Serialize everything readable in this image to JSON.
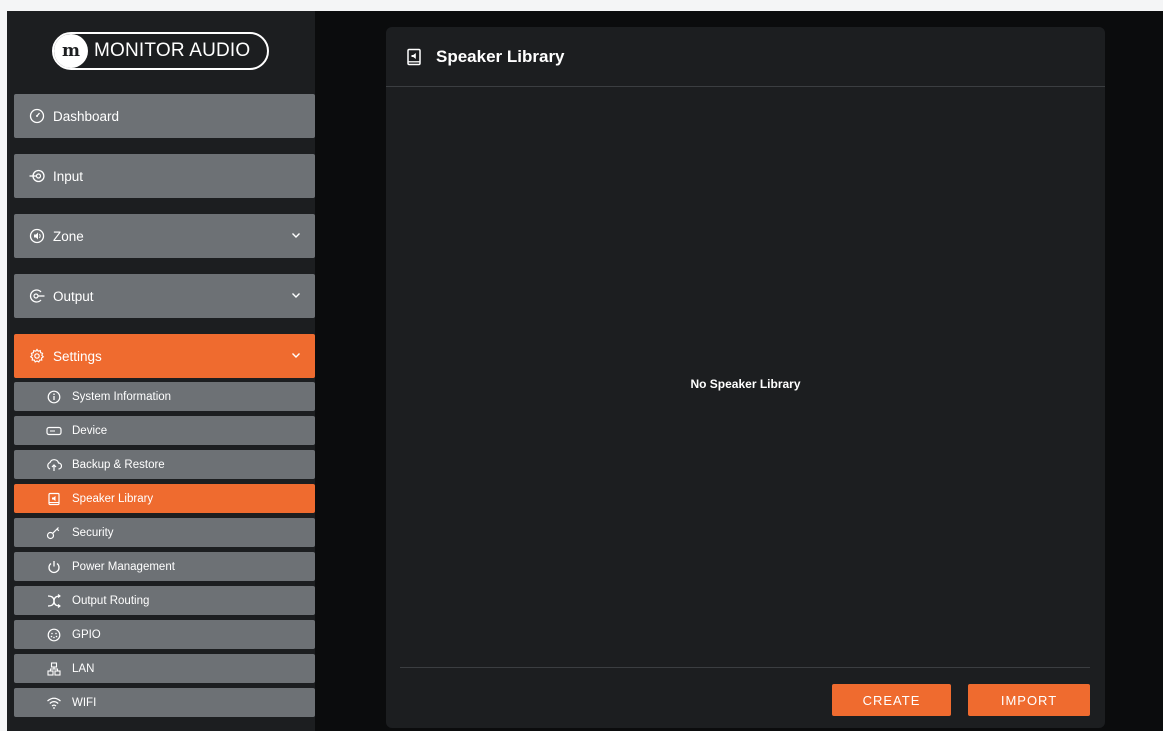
{
  "brand": {
    "logo_mark": "m",
    "logo_text": "MONITOR AUDIO"
  },
  "sidebar": {
    "main_items": [
      {
        "label": "Dashboard",
        "icon": "gauge-icon"
      },
      {
        "label": "Input",
        "icon": "input-icon"
      },
      {
        "label": "Zone",
        "icon": "speaker-icon",
        "expandable": true
      },
      {
        "label": "Output",
        "icon": "output-icon",
        "expandable": true
      },
      {
        "label": "Settings",
        "icon": "gear-icon",
        "expandable": true,
        "active": true
      }
    ],
    "settings_items": [
      {
        "label": "System Information",
        "icon": "info-icon"
      },
      {
        "label": "Device",
        "icon": "device-icon"
      },
      {
        "label": "Backup & Restore",
        "icon": "cloud-upload-icon"
      },
      {
        "label": "Speaker Library",
        "icon": "speaker-library-icon",
        "active": true
      },
      {
        "label": "Security",
        "icon": "key-icon"
      },
      {
        "label": "Power Management",
        "icon": "power-icon"
      },
      {
        "label": "Output Routing",
        "icon": "shuffle-icon"
      },
      {
        "label": "GPIO",
        "icon": "gpio-icon"
      },
      {
        "label": "LAN",
        "icon": "network-icon"
      },
      {
        "label": "WIFI",
        "icon": "wifi-icon"
      }
    ]
  },
  "main": {
    "title": "Speaker Library",
    "empty_message": "No Speaker Library",
    "create_label": "CREATE",
    "import_label": "IMPORT"
  },
  "colors": {
    "accent": "#ef6b2f",
    "nav_item": "#6d7175",
    "panel": "#1c1e20",
    "background": "#0b0c0d"
  }
}
